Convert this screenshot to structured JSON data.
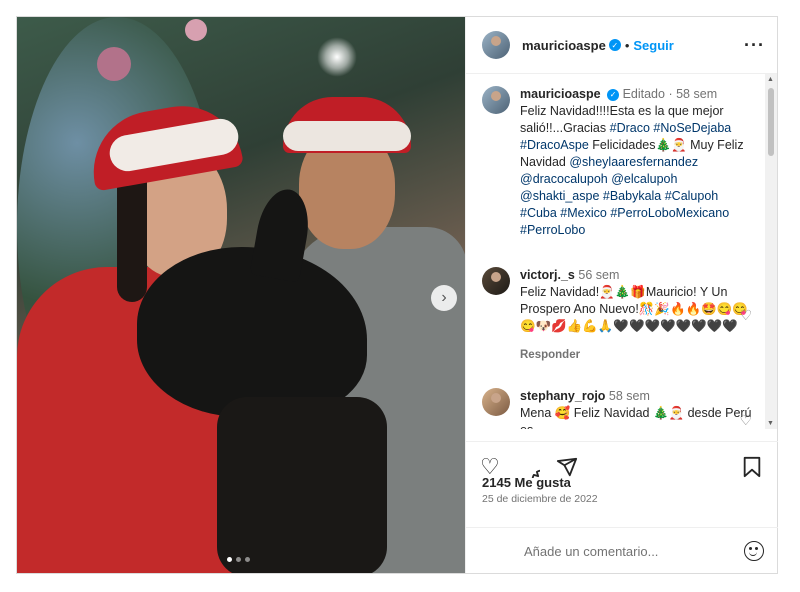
{
  "post": {
    "username": "mauricioaspe",
    "follow_label": "Seguir",
    "edited_label": "Editado",
    "time_ago": "58 sem",
    "caption_text": "Feliz Navidad!!!!Esta es la que mejor salió!!...Gracias ",
    "caption_tags_1": "#Draco #NoSeDejaba #DracoAspe",
    "caption_mid": " Felicidades🎄🎅 Muy Feliz Navidad ",
    "caption_tags_2": "@sheylaaresfernandez @dracocalupoh @elcalupoh @shakti_aspe #Babykala #Calupoh #Cuba #Mexico #PerroLoboMexicano #PerroLobo",
    "likes": "2145 Me gusta",
    "date": "25 de diciembre de 2022",
    "add_comment_placeholder": "Añade un comentario..."
  },
  "comments": [
    {
      "username": "victorj._s",
      "time_ago": "56 sem",
      "text": "Feliz Navidad!🎅🎄🎁Mauricio! Y Un Prospero Ano Nuevo!🎊🎉🔥🔥🤩😋😋😋🐶💋👍💪🙏🖤🖤🖤🖤🖤🖤🖤🖤",
      "reply_label": "Responder"
    },
    {
      "username": "stephany_rojo",
      "time_ago": "58 sem",
      "text": "Mena 🥰 Feliz Navidad 🎄🎅 desde Perú es..."
    }
  ],
  "carousel": {
    "count": 3,
    "active": 0
  },
  "icons": {
    "more": "more-options-icon",
    "like": "heart-icon",
    "comment": "comment-icon",
    "share": "share-icon",
    "save": "bookmark-icon",
    "next": "chevron-right-icon",
    "verified": "verified-badge-icon",
    "emoji": "emoji-icon"
  },
  "colors": {
    "link": "#0095f6",
    "tag": "#00376b",
    "muted": "#737373"
  }
}
